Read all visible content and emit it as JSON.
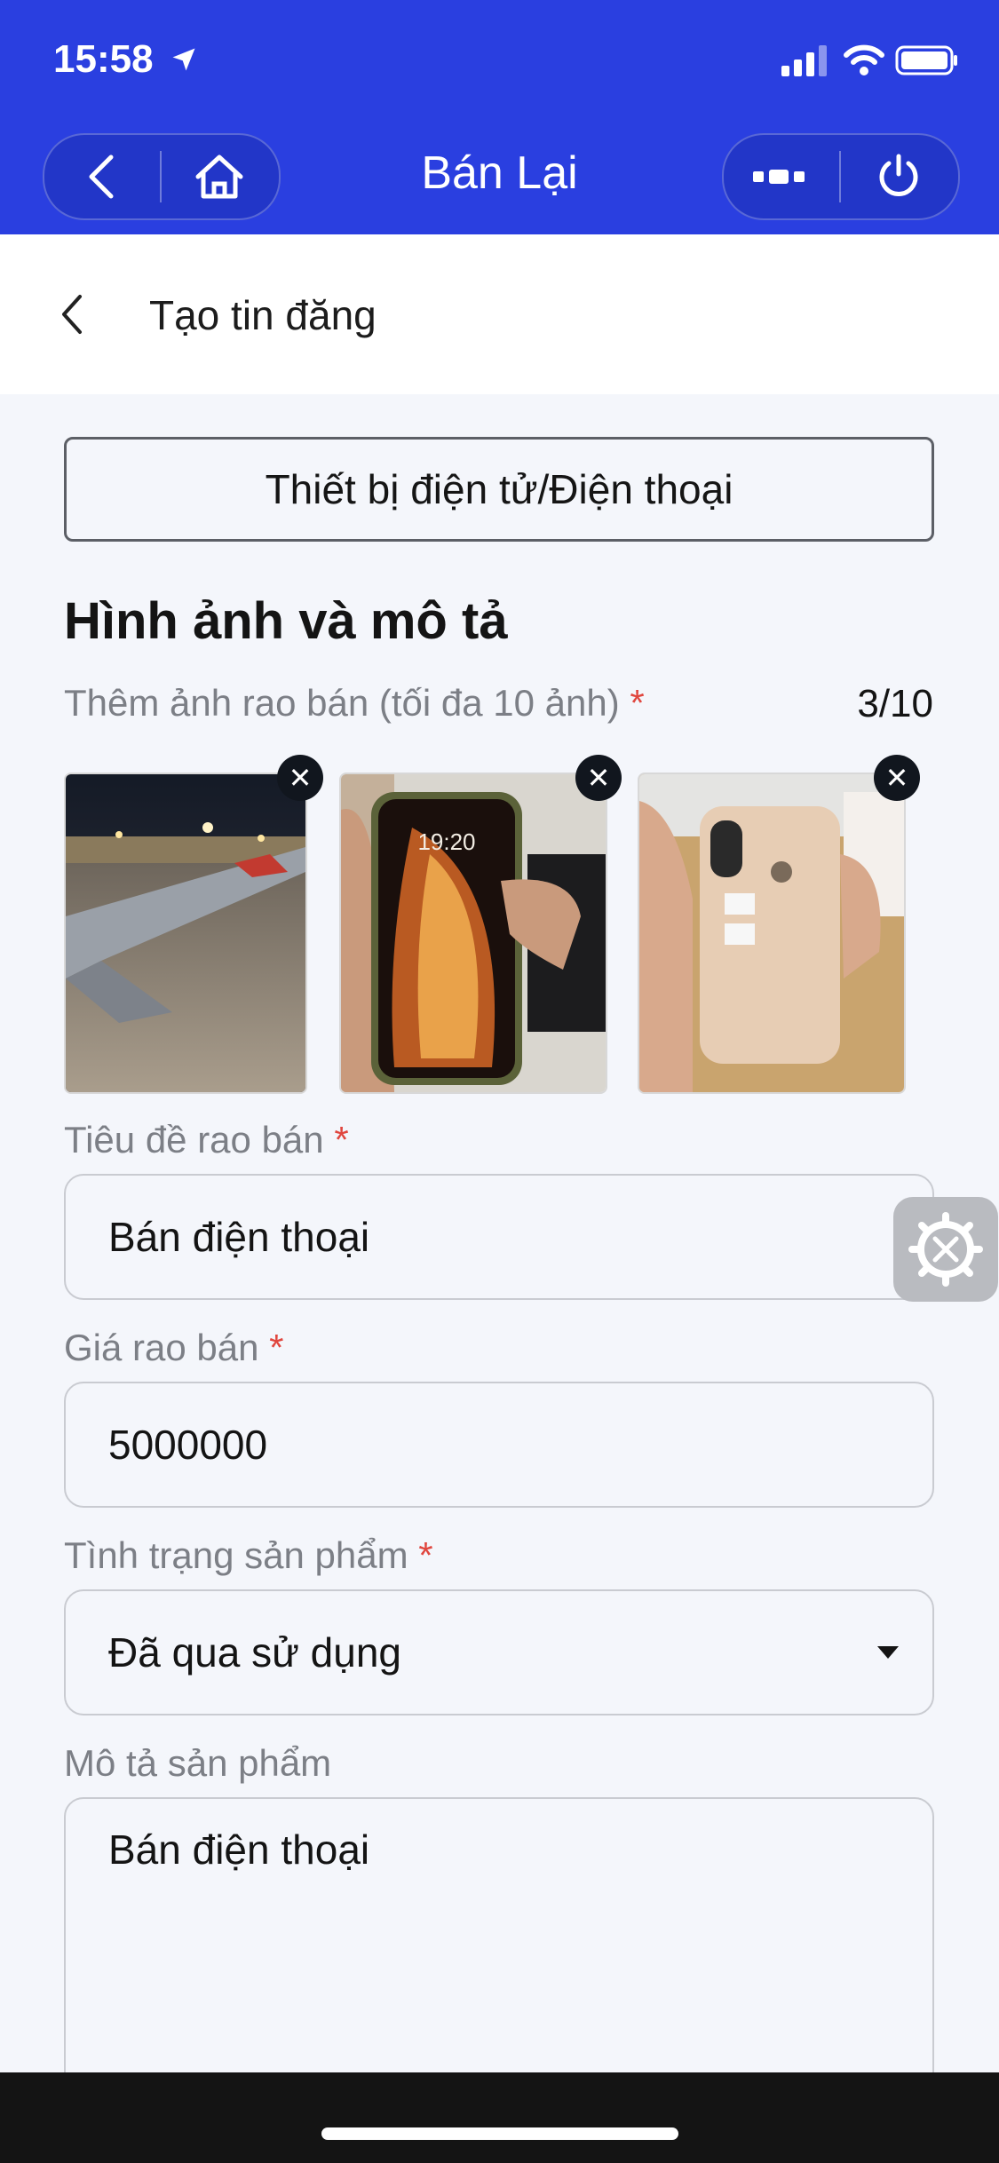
{
  "status": {
    "time": "15:58"
  },
  "nav": {
    "title": "Bán Lại"
  },
  "header": {
    "title": "Tạo tin đăng"
  },
  "category": {
    "label": "Thiết bị điện tử/Điện thoại"
  },
  "images_section": {
    "title": "Hình ảnh và mô tả",
    "add_label": "Thêm ảnh rao bán (tối đa 10 ảnh)",
    "required_mark": "*",
    "counter": "3/10",
    "phone_time": "19:20"
  },
  "form": {
    "title_label": "Tiêu đề rao bán",
    "title_value": "Bán điện thoại",
    "price_label": "Giá rao bán",
    "price_value": "5000000",
    "condition_label": "Tình trạng sản phẩm",
    "condition_value": "Đã qua sử dụng",
    "description_label": "Mô tả sản phẩm",
    "description_value": "Bán điện thoại",
    "required_mark": "*"
  },
  "colors": {
    "primary": "#2a3fe0",
    "required": "#e0463e"
  }
}
